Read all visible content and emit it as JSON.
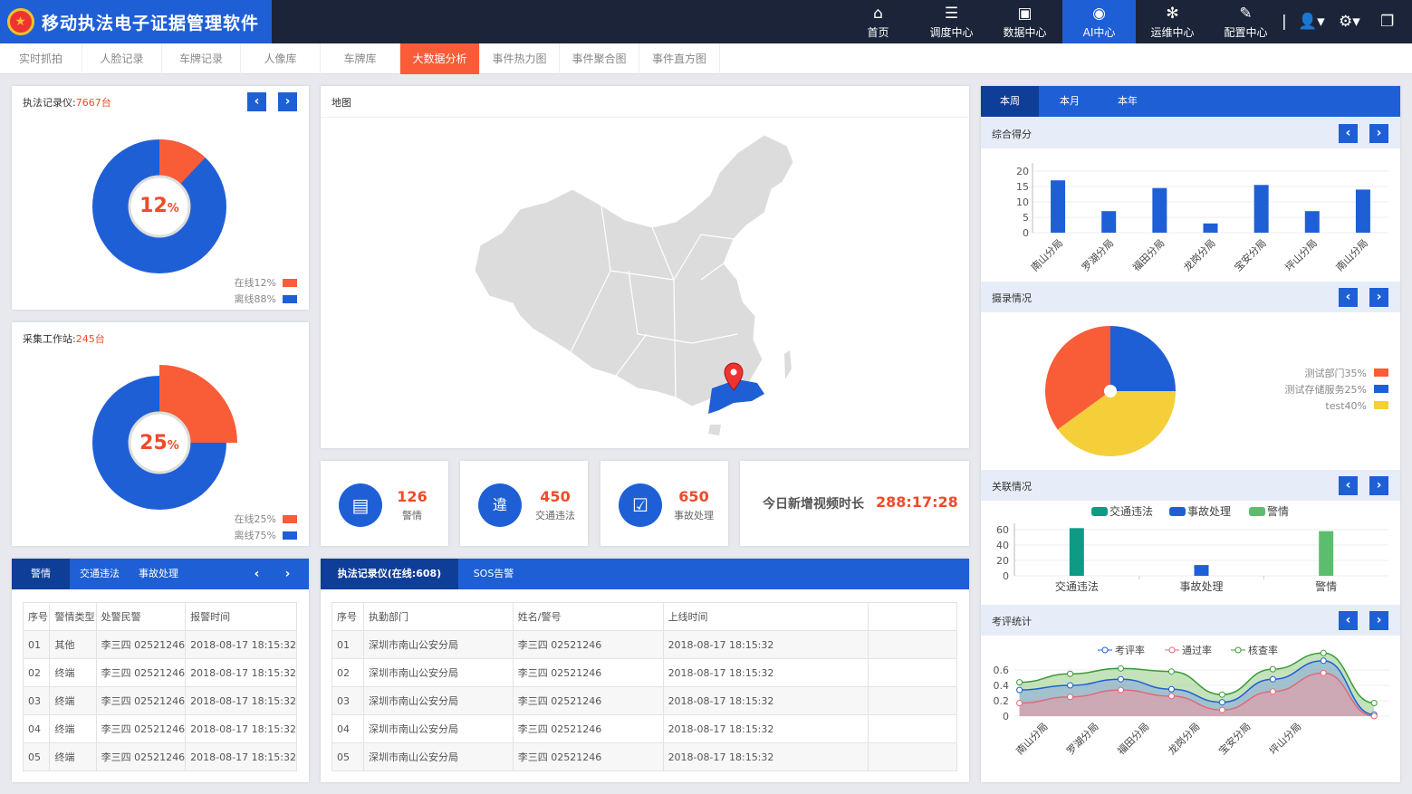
{
  "app": {
    "title": "移动执法电子证据管理软件"
  },
  "nav": [
    {
      "label": "首页",
      "icon": "⌂"
    },
    {
      "label": "调度中心",
      "icon": "☰"
    },
    {
      "label": "数据中心",
      "icon": "▣"
    },
    {
      "label": "AI中心",
      "icon": "◉"
    },
    {
      "label": "运维中心",
      "icon": "✻"
    },
    {
      "label": "配置中心",
      "icon": "✎"
    }
  ],
  "tabs": [
    "实时抓拍",
    "人脸记录",
    "车牌记录",
    "人像库",
    "车牌库",
    "大数据分析",
    "事件热力图",
    "事件聚合图",
    "事件直方图"
  ],
  "recorder": {
    "label": "执法记录仪:",
    "count": "7667台",
    "pct": "12",
    "unit": "%",
    "online": "在线12%",
    "offline": "离线88%",
    "online_frac": 0.12
  },
  "station": {
    "label": "采集工作站:",
    "count": "245台",
    "pct": "25",
    "unit": "%",
    "online": "在线25%",
    "offline": "离线75%",
    "online_frac": 0.25
  },
  "map": {
    "title": "地图"
  },
  "stats": [
    {
      "value": "126",
      "label": "警情",
      "icon": "📋"
    },
    {
      "value": "450",
      "label": "交通违法",
      "icon": "违"
    },
    {
      "value": "650",
      "label": "事故处理",
      "icon": "☑"
    }
  ],
  "video": {
    "label": "今日新增视频时长",
    "value": "288:17:28"
  },
  "alarm": {
    "tabs": [
      "警情",
      "交通违法",
      "事故处理"
    ],
    "headers": [
      "序号",
      "警情类型",
      "处警民警",
      "报警时间"
    ],
    "rows": [
      [
        "01",
        "其他",
        "李三四 02521246",
        "2018-08-17 18:15:32"
      ],
      [
        "02",
        "终端",
        "李三四 02521246",
        "2018-08-17 18:15:32"
      ],
      [
        "03",
        "终端",
        "李三四 02521246",
        "2018-08-17 18:15:32"
      ],
      [
        "04",
        "终端",
        "李三四 02521246",
        "2018-08-17 18:15:32"
      ],
      [
        "05",
        "终端",
        "李三四 02521246",
        "2018-08-17 18:15:32"
      ]
    ]
  },
  "rec_table": {
    "tabs": [
      "执法记录仪(在线:608)",
      "SOS告警"
    ],
    "headers": [
      "序号",
      "执勤部门",
      "姓名/警号",
      "上线时间",
      ""
    ],
    "rows": [
      [
        "01",
        "深圳市南山公安分局",
        "李三四 02521246",
        "2018-08-17 18:15:32",
        ""
      ],
      [
        "02",
        "深圳市南山公安分局",
        "李三四 02521246",
        "2018-08-17 18:15:32",
        ""
      ],
      [
        "03",
        "深圳市南山公安分局",
        "李三四 02521246",
        "2018-08-17 18:15:32",
        ""
      ],
      [
        "04",
        "深圳市南山公安分局",
        "李三四 02521246",
        "2018-08-17 18:15:32",
        ""
      ],
      [
        "05",
        "深圳市南山公安分局",
        "李三四 02521246",
        "2018-08-17 18:15:32",
        ""
      ]
    ]
  },
  "period": [
    "本周",
    "本月",
    "本年"
  ],
  "sections": {
    "score": "综合得分",
    "capture": "摄录情况",
    "relation": "关联情况",
    "assess": "考评统计"
  },
  "colors": {
    "blue": "#1f5fd6",
    "orange": "#f85d38",
    "yellow": "#f5cf3a",
    "teal": "#0d9b86",
    "green": "#5dbd6e"
  },
  "chart_data": [
    {
      "type": "bar",
      "title": "综合得分",
      "categories": [
        "南山分局",
        "罗湖分局",
        "福田分局",
        "龙岗分局",
        "宝安分局",
        "坪山分局",
        "南山分局"
      ],
      "values": [
        17,
        7,
        14.5,
        3,
        15.5,
        7,
        14
      ],
      "ylim": [
        0,
        20
      ],
      "yticks": [
        0,
        5,
        10,
        15,
        20
      ]
    },
    {
      "type": "pie",
      "title": "摄录情况",
      "labels": [
        "测试部门35%",
        "测试存储服务25%",
        "test40%"
      ],
      "values": [
        35,
        25,
        40
      ]
    },
    {
      "type": "bar",
      "title": "关联情况",
      "categories": [
        "交通违法",
        "事故处理",
        "警情"
      ],
      "series": [
        {
          "name": "交通违法",
          "values": [
            62,
            0,
            0
          ]
        },
        {
          "name": "事故处理",
          "values": [
            0,
            14,
            0
          ]
        },
        {
          "name": "警情",
          "values": [
            0,
            0,
            58
          ]
        }
      ],
      "ylim": [
        0,
        60
      ],
      "yticks": [
        0,
        20,
        40,
        60
      ]
    },
    {
      "type": "area",
      "title": "考评统计",
      "categories": [
        "南山分局",
        "罗湖分局",
        "福田分局",
        "龙岗分局",
        "宝安分局",
        "坪山分局"
      ],
      "series": [
        {
          "name": "考评率",
          "values": [
            0.34,
            0.4,
            0.48,
            0.35,
            0.18,
            0.48,
            0.72,
            0.02
          ]
        },
        {
          "name": "通过率",
          "values": [
            0.17,
            0.25,
            0.34,
            0.26,
            0.08,
            0.32,
            0.56,
            0.0
          ]
        },
        {
          "name": "核查率",
          "values": [
            0.44,
            0.55,
            0.62,
            0.58,
            0.28,
            0.61,
            0.82,
            0.17
          ]
        }
      ],
      "ylim": [
        0,
        0.6
      ],
      "yticks": [
        0,
        0.2,
        0.4,
        0.6
      ]
    }
  ]
}
